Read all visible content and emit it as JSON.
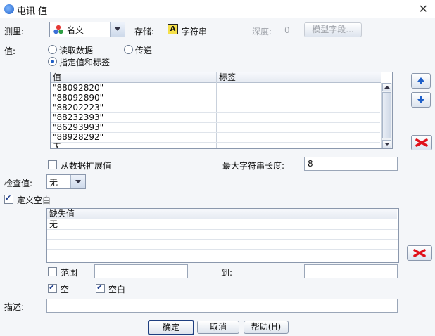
{
  "window": {
    "title": "屯讯 值",
    "close_icon": "close-icon"
  },
  "measure": {
    "label": "测里:",
    "value": "名义",
    "icon": "nominal-icon"
  },
  "storage": {
    "label": "存储:",
    "value": "字符串",
    "icon_letter": "A"
  },
  "depth": {
    "label": "深度:",
    "value": "0"
  },
  "model_field_button": "模型字段...",
  "values": {
    "label": "值:",
    "option_read": "读取数据",
    "option_pass": "传递",
    "option_specify": "指定值和标签",
    "selected": "specify",
    "table": {
      "headers": [
        "值",
        "标签"
      ],
      "rows": [
        [
          "\"88092820\"",
          ""
        ],
        [
          "\"88092890\"",
          ""
        ],
        [
          "\"88202223\"",
          ""
        ],
        [
          "\"88232393\"",
          ""
        ],
        [
          "\"86293993\"",
          ""
        ],
        [
          "\"88928292\"",
          ""
        ],
        [
          "无",
          ""
        ]
      ]
    }
  },
  "extend_from_data": {
    "label": "从数据扩展值",
    "checked": false
  },
  "max_string_length": {
    "label": "最大字符串长度:",
    "value": "8"
  },
  "check_values": {
    "label": "检查值:",
    "value": "无"
  },
  "define_blank": {
    "label": "定义空白",
    "checked": true
  },
  "missing_table": {
    "header": "缺失值",
    "rows": [
      "无",
      "",
      ""
    ]
  },
  "range": {
    "label": "范围",
    "checked": false,
    "to_label": "到:"
  },
  "null": {
    "label": "空",
    "checked": true
  },
  "whitespace": {
    "label": "空白",
    "checked": true
  },
  "description": {
    "label": "描述:",
    "value": ""
  },
  "buttons": {
    "ok": "确定",
    "cancel": "取消",
    "help": "帮助(H)"
  },
  "colors": {
    "accent": "#1e5fc8",
    "delete": "#e0101a"
  }
}
